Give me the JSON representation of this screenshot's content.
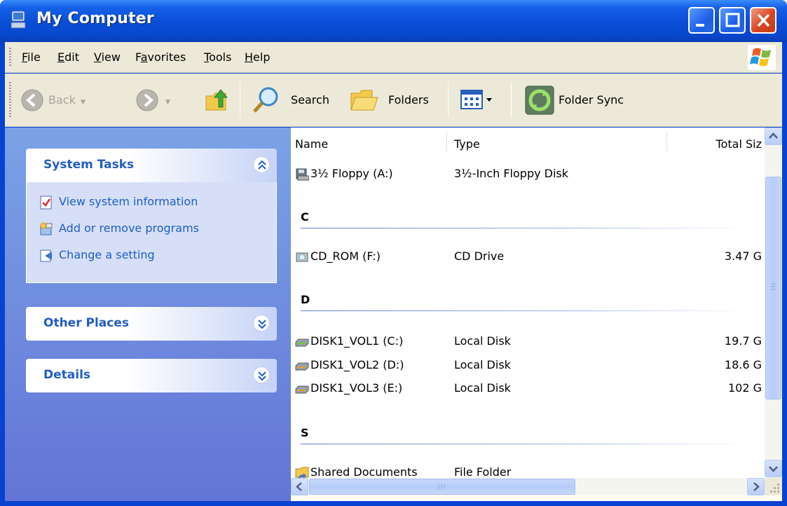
{
  "window": {
    "title": "My Computer"
  },
  "menu": [
    {
      "label": "File",
      "accel": "F",
      "rest": "ile"
    },
    {
      "label": "Edit",
      "accel": "E",
      "rest": "dit"
    },
    {
      "label": "View",
      "accel": "V",
      "rest": "iew"
    },
    {
      "label": "Favorites",
      "pre": "F",
      "accel": "a",
      "rest": "vorites"
    },
    {
      "label": "Tools",
      "accel": "T",
      "rest": "ools"
    },
    {
      "label": "Help",
      "accel": "H",
      "rest": "elp"
    }
  ],
  "toolbar": {
    "back_label": "Back",
    "search_label": "Search",
    "folders_label": "Folders",
    "foldersync_label": "Folder Sync"
  },
  "sidebar": {
    "system_tasks": {
      "title": "System Tasks",
      "items": [
        "View system information",
        "Add or remove programs",
        "Change a setting"
      ]
    },
    "other_places": {
      "title": "Other Places"
    },
    "details": {
      "title": "Details"
    }
  },
  "columns": {
    "name": "Name",
    "type": "Type",
    "size": "Total Siz"
  },
  "groups": [
    "C",
    "D",
    "S"
  ],
  "rows": [
    {
      "name": "3½ Floppy (A:)",
      "type": "3½-Inch Floppy Disk",
      "size": ""
    },
    {
      "name": "CD_ROM (F:)",
      "type": "CD Drive",
      "size": "3.47 G"
    },
    {
      "name": "DISK1_VOL1 (C:)",
      "type": "Local Disk",
      "size": "19.7 G"
    },
    {
      "name": "DISK1_VOL2 (D:)",
      "type": "Local Disk",
      "size": "18.6 G"
    },
    {
      "name": "DISK1_VOL3 (E:)",
      "type": "Local Disk",
      "size": "102 G"
    },
    {
      "name": "Shared Documents",
      "type": "File Folder",
      "size": ""
    }
  ],
  "colors": {
    "titlebar": "#0a4fd8",
    "sidebar_top": "#7ba2e7",
    "sidebar_bottom": "#6375d6",
    "task_link": "#215dc6"
  }
}
